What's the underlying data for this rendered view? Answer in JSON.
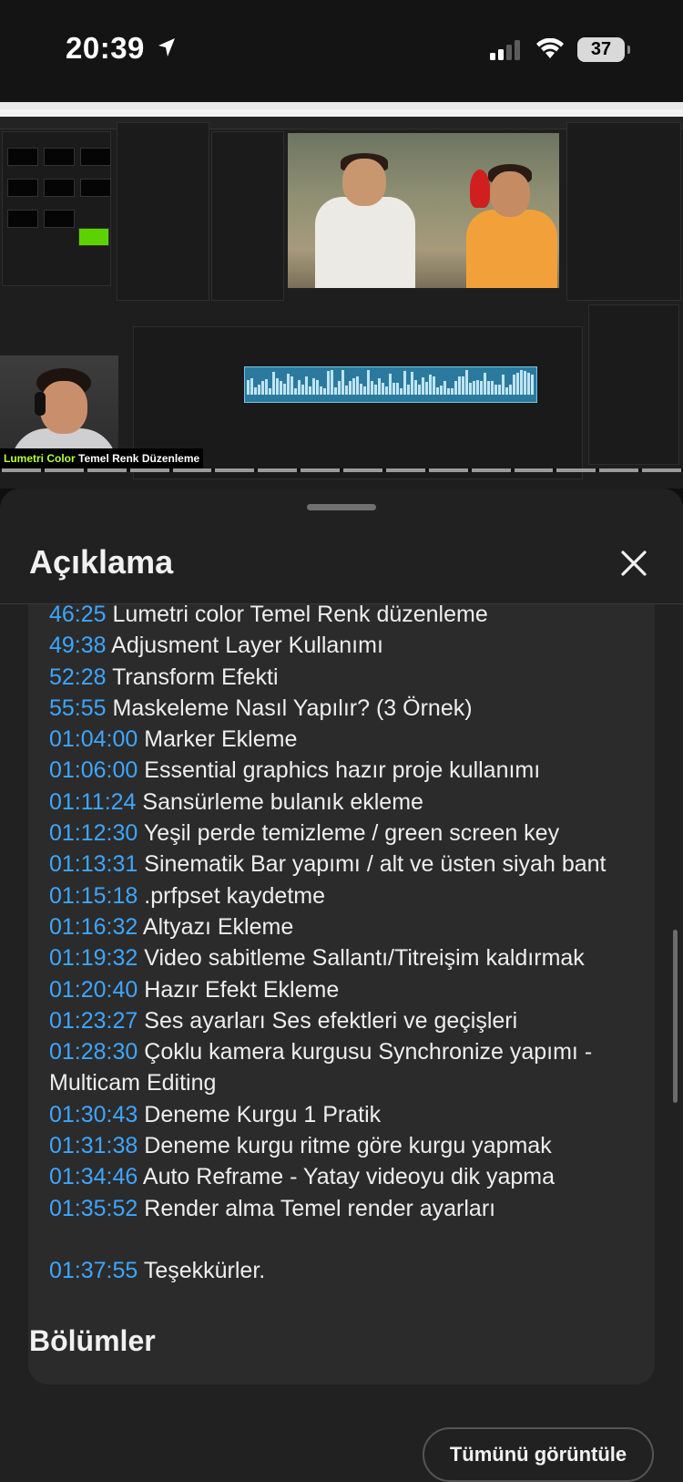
{
  "status_bar": {
    "time": "20:39",
    "battery": "37",
    "icons": [
      "location-arrow-icon",
      "cellular-signal-icon",
      "wifi-icon",
      "battery-icon"
    ]
  },
  "video": {
    "caption_highlight": "Lumetri Color",
    "caption_rest": "Temel Renk Düzenleme",
    "chapter_count": 16
  },
  "sheet": {
    "title": "Açıklama",
    "close_icon": "close-icon"
  },
  "description": {
    "top_partial": "",
    "chapters": [
      {
        "time": "46:25",
        "text": "Lumetri color Temel Renk düzenleme"
      },
      {
        "time": "49:38",
        "text": "Adjusment Layer Kullanımı"
      },
      {
        "time": "52:28",
        "text": "Transform Efekti"
      },
      {
        "time": "55:55",
        "text": "Maskeleme Nasıl Yapılır? (3 Örnek)"
      },
      {
        "time": "01:04:00",
        "text": "Marker Ekleme"
      },
      {
        "time": "01:06:00",
        "text": "Essential graphics hazır proje kullanımı"
      },
      {
        "time": "01:11:24",
        "text": "Sansürleme bulanık ekleme"
      },
      {
        "time": "01:12:30",
        "text": "Yeşil perde temizleme / green screen key"
      },
      {
        "time": "01:13:31",
        "text": "Sinematik Bar yapımı  / alt ve üsten siyah bant"
      },
      {
        "time": "01:15:18",
        "text": ".prfpset kaydetme"
      },
      {
        "time": "01:16:32",
        "text": "Altyazı Ekleme"
      },
      {
        "time": "01:19:32",
        "text": "Video sabitleme Sallantı/Titreişim kaldırmak"
      },
      {
        "time": "01:20:40",
        "text": "Hazır Efekt Ekleme"
      },
      {
        "time": "01:23:27",
        "text": "Ses ayarları Ses efektleri ve geçişleri"
      },
      {
        "time": "01:28:30",
        "text": "Çoklu kamera kurgusu Synchronize yapımı - Multicam Editing"
      },
      {
        "time": "01:30:43",
        "text": "Deneme Kurgu 1 Pratik"
      },
      {
        "time": "01:31:38",
        "text": "Deneme kurgu ritme göre kurgu yapmak"
      },
      {
        "time": "01:34:46",
        "text": "Auto Reframe - Yatay videoyu dik yapma"
      },
      {
        "time": "01:35:52",
        "text": "Render alma Temel render ayarları"
      }
    ],
    "closing": {
      "time": "01:37:55",
      "text": "Teşekkürler."
    }
  },
  "chapters_section": {
    "title": "Bölümler",
    "view_all_label": "Tümünü görüntüle"
  },
  "colors": {
    "timestamp": "#3ea6ff",
    "sheet_bg": "#212121",
    "card_bg": "#2b2b2b",
    "caption_highlight": "#b6ff3b"
  }
}
